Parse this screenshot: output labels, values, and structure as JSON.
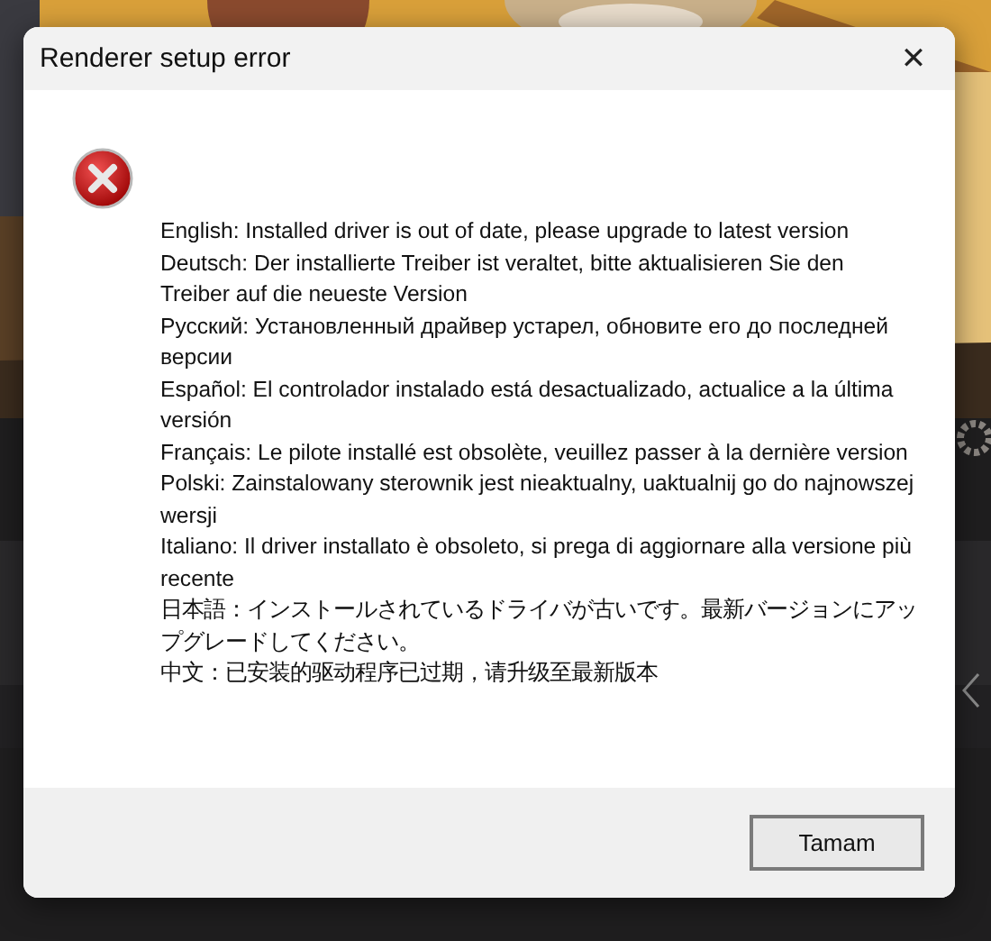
{
  "dialog": {
    "title": "Renderer setup error",
    "close": "✕",
    "messages": [
      {
        "text": "English: Installed driver is out of date, please upgrade to latest version"
      },
      {
        "text": "Deutsch: Der installierte Treiber ist veraltet, bitte aktualisieren Sie den Treiber auf die neueste Version"
      },
      {
        "text": "Русский: Установленный драйвер устарел, обновите его до последней версии"
      },
      {
        "text": "Español: El controlador instalado está desactualizado, actualice a la última versión"
      },
      {
        "text": "Français: Le pilote installé est obsolète, veuillez passer à la dernière version"
      },
      {
        "text": "Polski: Zainstalowany sterownik jest nieaktualny, uaktualnij go do najnowszej wersji"
      },
      {
        "text": "Italiano: Il driver installato è obsoleto, si prega di aggiornare alla versione più recente"
      },
      {
        "text": "日本語：インストールされているドライバが古いです。最新バージョンにアップグレードしてください。"
      },
      {
        "text": "中文：已安装的驱动程序已过期，请升级至最新版本"
      }
    ],
    "buttons": [
      {
        "label": "Tamam"
      }
    ]
  }
}
